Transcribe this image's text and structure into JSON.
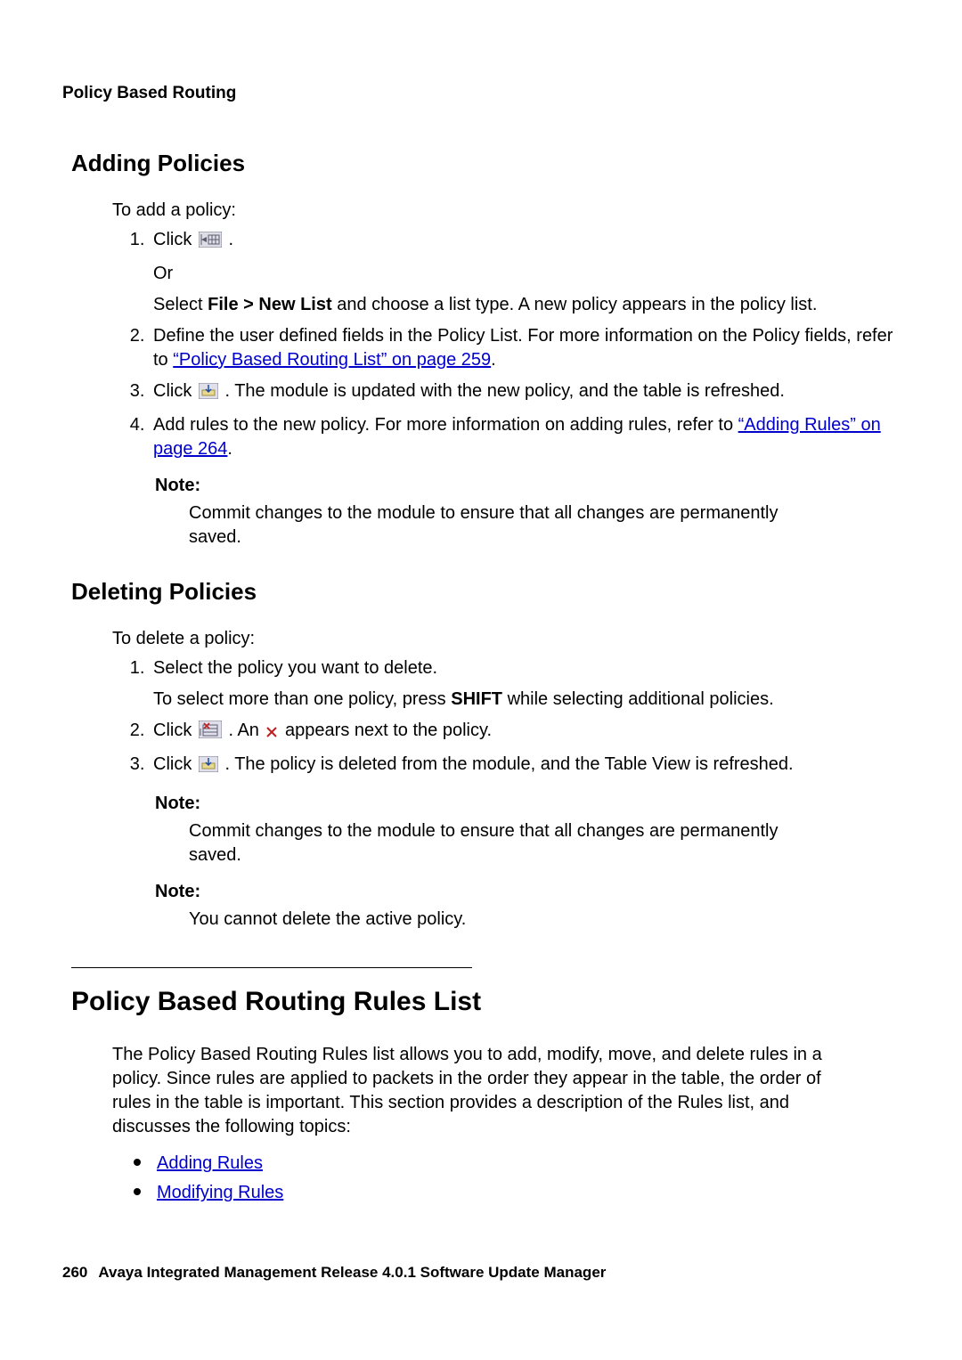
{
  "header": "Policy Based Routing",
  "addPolicies": {
    "heading": "Adding Policies",
    "intro": "To add a policy:",
    "steps": {
      "s1_a": "Click ",
      "s1_b": ".",
      "or": "Or",
      "s1_c_a": "Select ",
      "s1_c_bold": "File > New List",
      "s1_c_b": " and choose a list type. A new policy appears in the policy list.",
      "s2_a": "Define the user defined fields in the Policy List. For more information on the Policy fields, refer to ",
      "s2_link": "“Policy Based Routing List” on page 259",
      "s2_b": ".",
      "s3_a": "Click ",
      "s3_b": ". The module is updated with the new policy, and the table is refreshed.",
      "s4_a": "Add rules to the new policy. For more information on adding rules, refer to ",
      "s4_link": "“Adding Rules” on page 264",
      "s4_b": "."
    },
    "note_label": "Note:",
    "note_body": "Commit changes to the module to ensure that all changes are permanently saved."
  },
  "delPolicies": {
    "heading": "Deleting Policies",
    "intro": "To delete a policy:",
    "steps": {
      "s1": "Select the policy you want to delete.",
      "s1_sub_a": "To select more than one policy, press ",
      "s1_sub_bold": "SHIFT",
      "s1_sub_b": " while selecting additional policies.",
      "s2_a": "Click ",
      "s2_b": ". An ",
      "s2_c": " appears next to the policy.",
      "s3_a": "Click ",
      "s3_b": ". The policy is deleted from the module, and the Table View is refreshed."
    },
    "note1_label": "Note:",
    "note1_body": "Commit changes to the module to ensure that all changes are permanently saved.",
    "note2_label": "Note:",
    "note2_body": "You cannot delete the active policy."
  },
  "rulesList": {
    "heading": "Policy Based Routing Rules List",
    "body": "The Policy Based Routing Rules list allows you to add, modify, move, and delete rules in a policy. Since rules are applied to packets in the order they appear in the table, the order of rules in the table is important. This section provides a description of the Rules list, and discusses the following topics:",
    "links": {
      "l1": "Adding Rules",
      "l2": "Modifying Rules"
    }
  },
  "footer": {
    "page": "260",
    "title": "Avaya Integrated Management Release 4.0.1 Software Update Manager"
  }
}
